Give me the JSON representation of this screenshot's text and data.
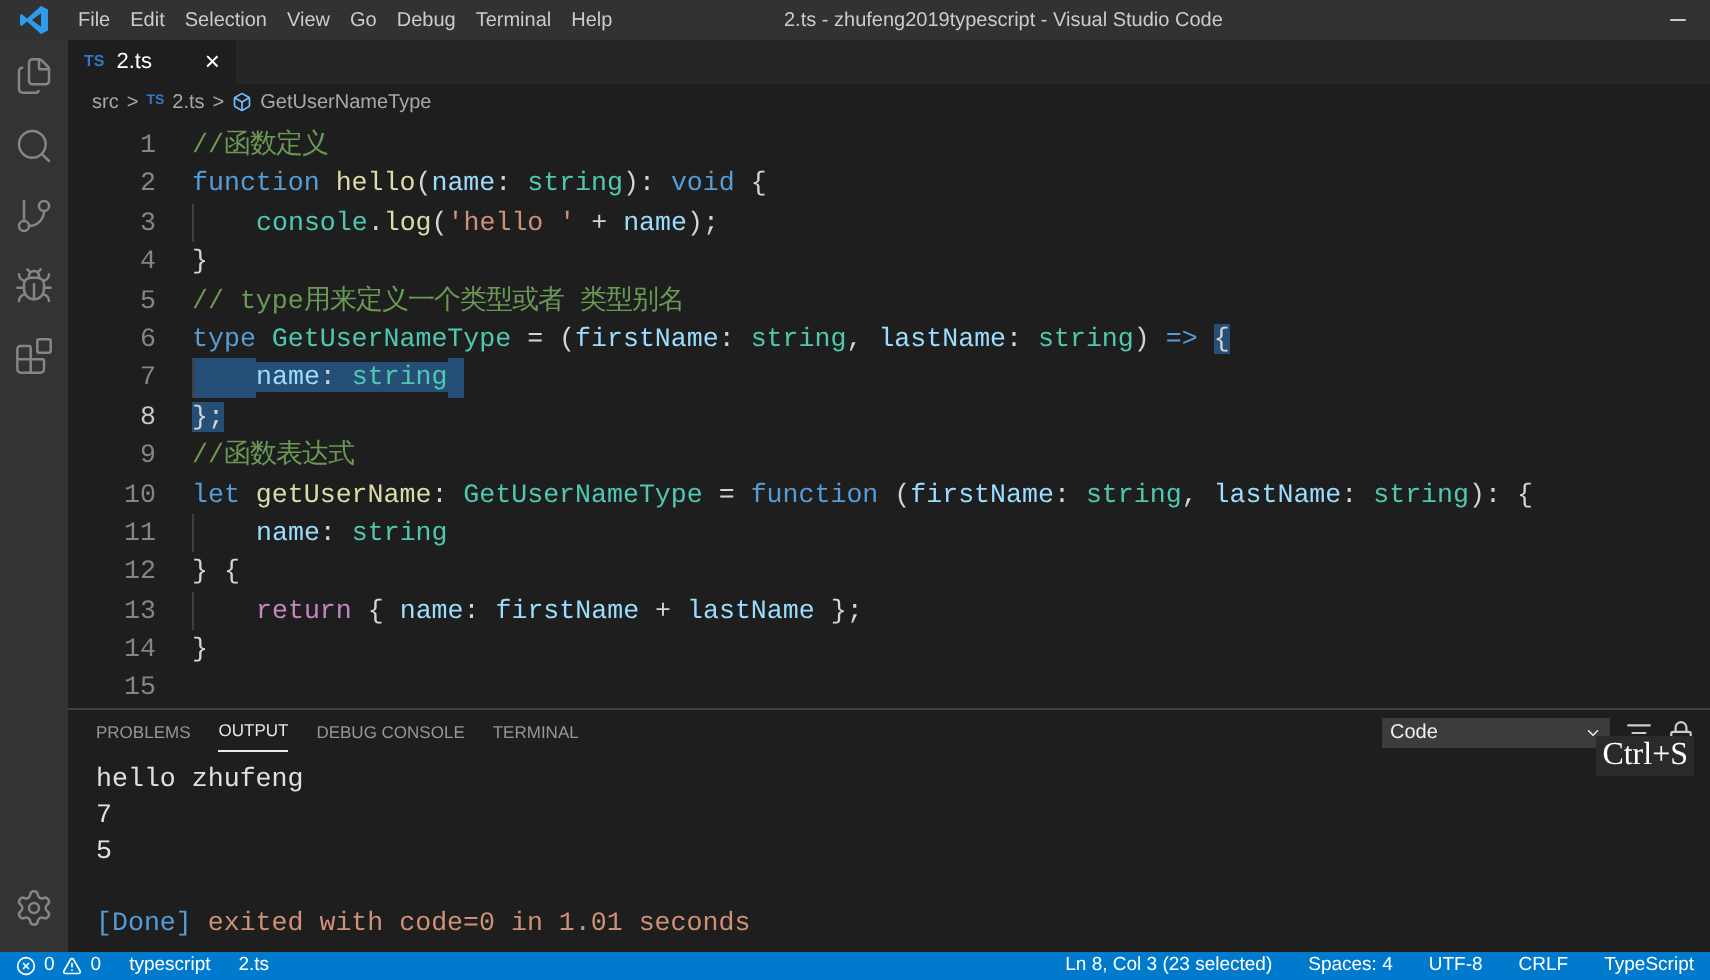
{
  "window": {
    "title": "2.ts - zhufeng2019typescript - Visual Studio Code"
  },
  "menu": [
    "File",
    "Edit",
    "Selection",
    "View",
    "Go",
    "Debug",
    "Terminal",
    "Help"
  ],
  "tabs": [
    {
      "badge": "TS",
      "label": "2.ts",
      "selected": true,
      "close": "×"
    }
  ],
  "breadcrumb": [
    {
      "kind": "folder",
      "label": "src"
    },
    {
      "kind": "file",
      "badge": "TS",
      "label": "2.ts"
    },
    {
      "kind": "symbol",
      "label": "GetUserNameType"
    }
  ],
  "breadcrumb_separator": ">",
  "editor": {
    "lines": [
      {
        "number": "1",
        "current": false,
        "tokens": [
          {
            "kind": "comment",
            "text": "//函数定义",
            "selected": false
          }
        ]
      },
      {
        "number": "2",
        "current": false,
        "tokens": [
          {
            "kind": "keyword",
            "text": "function ",
            "selected": false
          },
          {
            "kind": "function",
            "text": "hello",
            "selected": false
          },
          {
            "kind": "punct",
            "text": "(",
            "selected": false
          },
          {
            "kind": "variable",
            "text": "name",
            "selected": false
          },
          {
            "kind": "punct",
            "text": ": ",
            "selected": false
          },
          {
            "kind": "type",
            "text": "string",
            "selected": false
          },
          {
            "kind": "punct",
            "text": "): ",
            "selected": false
          },
          {
            "kind": "keyword",
            "text": "void",
            "selected": false
          },
          {
            "kind": "punct",
            "text": " {",
            "selected": false
          }
        ]
      },
      {
        "number": "3",
        "current": false,
        "indent": true,
        "tokens": [
          {
            "kind": "type",
            "text": "console",
            "selected": false
          },
          {
            "kind": "punct",
            "text": ".",
            "selected": false
          },
          {
            "kind": "function",
            "text": "log",
            "selected": false
          },
          {
            "kind": "punct",
            "text": "(",
            "selected": false
          },
          {
            "kind": "string",
            "text": "'hello '",
            "selected": false
          },
          {
            "kind": "punct",
            "text": " + ",
            "selected": false
          },
          {
            "kind": "variable",
            "text": "name",
            "selected": false
          },
          {
            "kind": "punct",
            "text": ");",
            "selected": false
          }
        ]
      },
      {
        "number": "4",
        "current": false,
        "tokens": [
          {
            "kind": "punct",
            "text": "}",
            "selected": false
          }
        ]
      },
      {
        "number": "5",
        "current": false,
        "tokens": [
          {
            "kind": "comment",
            "text": "// type用来定义一个类型或者 类型别名",
            "selected": false
          }
        ]
      },
      {
        "number": "6",
        "current": false,
        "tokens": [
          {
            "kind": "keyword",
            "text": "type ",
            "selected": false
          },
          {
            "kind": "type",
            "text": "GetUserNameType",
            "selected": false
          },
          {
            "kind": "punct",
            "text": " = (",
            "selected": false
          },
          {
            "kind": "variable",
            "text": "firstName",
            "selected": false
          },
          {
            "kind": "punct",
            "text": ": ",
            "selected": false
          },
          {
            "kind": "type",
            "text": "string",
            "selected": false
          },
          {
            "kind": "punct",
            "text": ", ",
            "selected": false
          },
          {
            "kind": "variable",
            "text": "lastName",
            "selected": false
          },
          {
            "kind": "punct",
            "text": ": ",
            "selected": false
          },
          {
            "kind": "type",
            "text": "string",
            "selected": false
          },
          {
            "kind": "punct",
            "text": ") ",
            "selected": false
          },
          {
            "kind": "keyword",
            "text": "=> ",
            "selected": false
          },
          {
            "kind": "punct",
            "text": "{",
            "selected": true
          }
        ]
      },
      {
        "number": "7",
        "current": false,
        "indent": true,
        "tokens": [
          {
            "kind": "variable",
            "text": "name",
            "selected": true
          },
          {
            "kind": "punct",
            "text": ": ",
            "selected": true
          },
          {
            "kind": "type",
            "text": "string",
            "selected": true
          }
        ]
      },
      {
        "number": "8",
        "current": true,
        "tokens": [
          {
            "kind": "punct",
            "text": "};",
            "selected": true
          }
        ]
      },
      {
        "number": "9",
        "current": false,
        "tokens": [
          {
            "kind": "comment",
            "text": "//函数表达式",
            "selected": false
          }
        ]
      },
      {
        "number": "10",
        "current": false,
        "tokens": [
          {
            "kind": "keyword",
            "text": "let ",
            "selected": false
          },
          {
            "kind": "function",
            "text": "getUserName",
            "selected": false
          },
          {
            "kind": "punct",
            "text": ": ",
            "selected": false
          },
          {
            "kind": "type",
            "text": "GetUserNameType",
            "selected": false
          },
          {
            "kind": "punct",
            "text": " = ",
            "selected": false
          },
          {
            "kind": "keyword",
            "text": "function",
            "selected": false
          },
          {
            "kind": "punct",
            "text": " (",
            "selected": false
          },
          {
            "kind": "variable",
            "text": "firstName",
            "selected": false
          },
          {
            "kind": "punct",
            "text": ": ",
            "selected": false
          },
          {
            "kind": "type",
            "text": "string",
            "selected": false
          },
          {
            "kind": "punct",
            "text": ", ",
            "selected": false
          },
          {
            "kind": "variable",
            "text": "lastName",
            "selected": false
          },
          {
            "kind": "punct",
            "text": ": ",
            "selected": false
          },
          {
            "kind": "type",
            "text": "string",
            "selected": false
          },
          {
            "kind": "punct",
            "text": "): {",
            "selected": false
          }
        ]
      },
      {
        "number": "11",
        "current": false,
        "indent": true,
        "tokens": [
          {
            "kind": "variable",
            "text": "name",
            "selected": false
          },
          {
            "kind": "punct",
            "text": ": ",
            "selected": false
          },
          {
            "kind": "type",
            "text": "string",
            "selected": false
          }
        ]
      },
      {
        "number": "12",
        "current": false,
        "tokens": [
          {
            "kind": "punct",
            "text": "} {",
            "selected": false
          }
        ]
      },
      {
        "number": "13",
        "current": false,
        "indent": true,
        "tokens": [
          {
            "kind": "control",
            "text": "return",
            "selected": false
          },
          {
            "kind": "punct",
            "text": " { ",
            "selected": false
          },
          {
            "kind": "variable",
            "text": "name",
            "selected": false
          },
          {
            "kind": "punct",
            "text": ": ",
            "selected": false
          },
          {
            "kind": "variable",
            "text": "firstName",
            "selected": false
          },
          {
            "kind": "punct",
            "text": " + ",
            "selected": false
          },
          {
            "kind": "variable",
            "text": "lastName",
            "selected": false
          },
          {
            "kind": "punct",
            "text": " };",
            "selected": false
          }
        ]
      },
      {
        "number": "14",
        "current": false,
        "tokens": [
          {
            "kind": "punct",
            "text": "}",
            "selected": false
          }
        ]
      },
      {
        "number": "15",
        "current": false
      }
    ]
  },
  "panel": {
    "tabs": [
      {
        "label": "PROBLEMS",
        "selected": false
      },
      {
        "label": "OUTPUT",
        "selected": true
      },
      {
        "label": "DEBUG CONSOLE",
        "selected": false
      },
      {
        "label": "TERMINAL",
        "selected": false
      }
    ],
    "channel": "Code",
    "output": [
      {
        "kind": "plain",
        "text": "hello zhufeng"
      },
      {
        "kind": "plain",
        "text": "7"
      },
      {
        "kind": "plain",
        "text": "5"
      },
      {
        "kind": "blank"
      },
      {
        "kind": "done",
        "tag": "[Done]",
        "text": " exited with code=0 in 1.01 seconds"
      }
    ]
  },
  "keystroke": "Ctrl+S",
  "status_bar": {
    "errors": "0",
    "warnings": "0",
    "left": [
      {
        "label": "typescript"
      },
      {
        "label": "2.ts"
      }
    ],
    "right": [
      "Ln 8, Col 3 (23 selected)",
      "Spaces: 4",
      "UTF-8",
      "CRLF",
      "TypeScript"
    ]
  }
}
